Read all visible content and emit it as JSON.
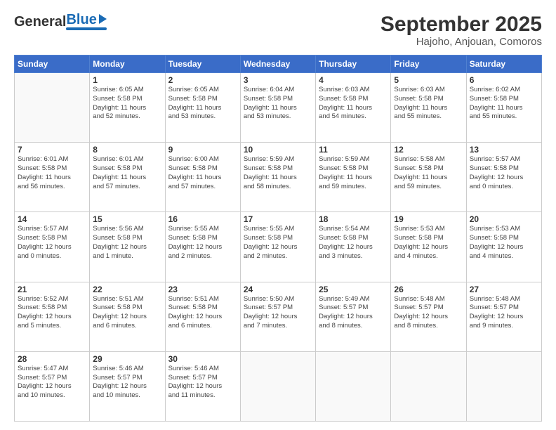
{
  "header": {
    "logo": {
      "general": "General",
      "blue": "Blue"
    },
    "title": "September 2025",
    "subtitle": "Hajoho, Anjouan, Comoros"
  },
  "calendar": {
    "days_of_week": [
      "Sunday",
      "Monday",
      "Tuesday",
      "Wednesday",
      "Thursday",
      "Friday",
      "Saturday"
    ],
    "weeks": [
      [
        {
          "day": "",
          "info": ""
        },
        {
          "day": "1",
          "info": "Sunrise: 6:05 AM\nSunset: 5:58 PM\nDaylight: 11 hours\nand 52 minutes."
        },
        {
          "day": "2",
          "info": "Sunrise: 6:05 AM\nSunset: 5:58 PM\nDaylight: 11 hours\nand 53 minutes."
        },
        {
          "day": "3",
          "info": "Sunrise: 6:04 AM\nSunset: 5:58 PM\nDaylight: 11 hours\nand 53 minutes."
        },
        {
          "day": "4",
          "info": "Sunrise: 6:03 AM\nSunset: 5:58 PM\nDaylight: 11 hours\nand 54 minutes."
        },
        {
          "day": "5",
          "info": "Sunrise: 6:03 AM\nSunset: 5:58 PM\nDaylight: 11 hours\nand 55 minutes."
        },
        {
          "day": "6",
          "info": "Sunrise: 6:02 AM\nSunset: 5:58 PM\nDaylight: 11 hours\nand 55 minutes."
        }
      ],
      [
        {
          "day": "7",
          "info": "Sunrise: 6:01 AM\nSunset: 5:58 PM\nDaylight: 11 hours\nand 56 minutes."
        },
        {
          "day": "8",
          "info": "Sunrise: 6:01 AM\nSunset: 5:58 PM\nDaylight: 11 hours\nand 57 minutes."
        },
        {
          "day": "9",
          "info": "Sunrise: 6:00 AM\nSunset: 5:58 PM\nDaylight: 11 hours\nand 57 minutes."
        },
        {
          "day": "10",
          "info": "Sunrise: 5:59 AM\nSunset: 5:58 PM\nDaylight: 11 hours\nand 58 minutes."
        },
        {
          "day": "11",
          "info": "Sunrise: 5:59 AM\nSunset: 5:58 PM\nDaylight: 11 hours\nand 59 minutes."
        },
        {
          "day": "12",
          "info": "Sunrise: 5:58 AM\nSunset: 5:58 PM\nDaylight: 11 hours\nand 59 minutes."
        },
        {
          "day": "13",
          "info": "Sunrise: 5:57 AM\nSunset: 5:58 PM\nDaylight: 12 hours\nand 0 minutes."
        }
      ],
      [
        {
          "day": "14",
          "info": "Sunrise: 5:57 AM\nSunset: 5:58 PM\nDaylight: 12 hours\nand 0 minutes."
        },
        {
          "day": "15",
          "info": "Sunrise: 5:56 AM\nSunset: 5:58 PM\nDaylight: 12 hours\nand 1 minute."
        },
        {
          "day": "16",
          "info": "Sunrise: 5:55 AM\nSunset: 5:58 PM\nDaylight: 12 hours\nand 2 minutes."
        },
        {
          "day": "17",
          "info": "Sunrise: 5:55 AM\nSunset: 5:58 PM\nDaylight: 12 hours\nand 2 minutes."
        },
        {
          "day": "18",
          "info": "Sunrise: 5:54 AM\nSunset: 5:58 PM\nDaylight: 12 hours\nand 3 minutes."
        },
        {
          "day": "19",
          "info": "Sunrise: 5:53 AM\nSunset: 5:58 PM\nDaylight: 12 hours\nand 4 minutes."
        },
        {
          "day": "20",
          "info": "Sunrise: 5:53 AM\nSunset: 5:58 PM\nDaylight: 12 hours\nand 4 minutes."
        }
      ],
      [
        {
          "day": "21",
          "info": "Sunrise: 5:52 AM\nSunset: 5:58 PM\nDaylight: 12 hours\nand 5 minutes."
        },
        {
          "day": "22",
          "info": "Sunrise: 5:51 AM\nSunset: 5:58 PM\nDaylight: 12 hours\nand 6 minutes."
        },
        {
          "day": "23",
          "info": "Sunrise: 5:51 AM\nSunset: 5:58 PM\nDaylight: 12 hours\nand 6 minutes."
        },
        {
          "day": "24",
          "info": "Sunrise: 5:50 AM\nSunset: 5:57 PM\nDaylight: 12 hours\nand 7 minutes."
        },
        {
          "day": "25",
          "info": "Sunrise: 5:49 AM\nSunset: 5:57 PM\nDaylight: 12 hours\nand 8 minutes."
        },
        {
          "day": "26",
          "info": "Sunrise: 5:48 AM\nSunset: 5:57 PM\nDaylight: 12 hours\nand 8 minutes."
        },
        {
          "day": "27",
          "info": "Sunrise: 5:48 AM\nSunset: 5:57 PM\nDaylight: 12 hours\nand 9 minutes."
        }
      ],
      [
        {
          "day": "28",
          "info": "Sunrise: 5:47 AM\nSunset: 5:57 PM\nDaylight: 12 hours\nand 10 minutes."
        },
        {
          "day": "29",
          "info": "Sunrise: 5:46 AM\nSunset: 5:57 PM\nDaylight: 12 hours\nand 10 minutes."
        },
        {
          "day": "30",
          "info": "Sunrise: 5:46 AM\nSunset: 5:57 PM\nDaylight: 12 hours\nand 11 minutes."
        },
        {
          "day": "",
          "info": ""
        },
        {
          "day": "",
          "info": ""
        },
        {
          "day": "",
          "info": ""
        },
        {
          "day": "",
          "info": ""
        }
      ]
    ]
  }
}
